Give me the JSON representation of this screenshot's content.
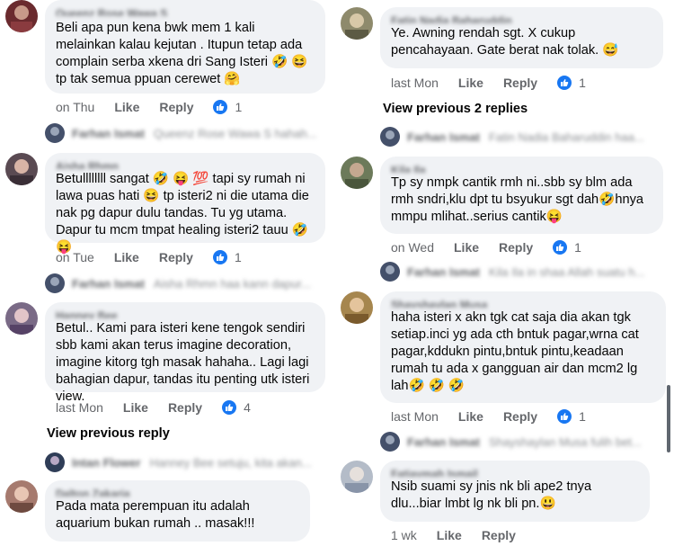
{
  "left": {
    "comments": [
      {
        "author": "Queenz Rose Wawa S",
        "text": "Beli apa pun kena bwk mem 1 kali melainkan kalau kejutan . Itupun tetap ada complain serba xkena dri Sang Isteri 🤣 😆 tp tak semua ppuan cerewet 🤗",
        "time": "on Thu",
        "like": "Like",
        "reply": "Reply",
        "reactions": "1",
        "preview": {
          "name": "Farhan Ismat",
          "text": "Queenz Rose Wawa S hahah..."
        }
      },
      {
        "author": "Aisha Rhmn",
        "text": "Betullllllll sangat 🤣 😝 💯 tapi sy rumah ni lawa puas hati 😆 tp isteri2 ni die utama die nak pg dapur dulu tandas. Tu yg utama. Dapur tu mcm tmpat healing isteri2 tauu 🤣 😝",
        "time": "on Tue",
        "like": "Like",
        "reply": "Reply",
        "reactions": "1",
        "preview": {
          "name": "Farhan Ismat",
          "text": "Aisha Rhmn haa kann dapur..."
        }
      },
      {
        "author": "Hanney Bee",
        "text": "Betul.. Kami para isteri kene tengok sendiri sbb kami akan terus imagine decoration, imagine kitorg tgh masak hahaha.. Lagi lagi bahagian dapur, tandas itu penting utk isteri view.",
        "time": "last Mon",
        "like": "Like",
        "reply": "Reply",
        "reactions": "4",
        "view_more": "View previous reply",
        "preview": {
          "name": "Intan Flower",
          "text": "Hanney Bee setuju, kita akan..."
        }
      },
      {
        "author": "Dalton Zakaria",
        "text": "Pada mata perempuan itu adalah aquarium bukan rumah .. masak!!!"
      }
    ]
  },
  "right": {
    "comments": [
      {
        "author": "Fatin Nadia Baharuddin",
        "text": "Ye. Awning rendah sgt. X cukup pencahayaan. Gate berat nak tolak. 😅",
        "time": "last Mon",
        "like": "Like",
        "reply": "Reply",
        "reactions": "1",
        "view_more": "View previous 2 replies",
        "preview": {
          "name": "Farhan Ismat",
          "text": "Fatin Nadia Baharuddin haa..."
        }
      },
      {
        "author": "Kila Ila",
        "text": "Tp sy nmpk cantik rmh ni..sbb sy blm ada rmh sndri,klu dpt tu bsyukur sgt dah🤣hnya mmpu mlihat..serius cantik😝",
        "time": "on Wed",
        "like": "Like",
        "reply": "Reply",
        "reactions": "1",
        "preview": {
          "name": "Farhan Ismat",
          "text": "Kila Ila in shaa Allah suatu h..."
        }
      },
      {
        "author": "Shayshaylan Musa",
        "text": "haha isteri x akn tgk cat saja dia akan tgk setiap.inci yg ada cth bntuk pagar,wrna cat pagar,kddukn pintu,bntuk pintu,keadaan rumah tu ada x gangguan air dan mcm2 lg lah🤣 🤣 🤣",
        "time": "last Mon",
        "like": "Like",
        "reply": "Reply",
        "reactions": "1",
        "preview": {
          "name": "Farhan Ismat",
          "text": "Shayshaylan Musa fulih bet..."
        }
      },
      {
        "author": "Fatiaymah Ismail",
        "text": "Nsib suami sy jnis nk bli ape2 tnya dlu...biar lmbt lg nk bli pn.😃",
        "time": "1 wk",
        "like": "Like",
        "reply": "Reply"
      }
    ]
  },
  "colors": {
    "bubble": "#f0f2f5",
    "meta": "#65676b",
    "like_badge": "#1877f2"
  },
  "icons": {
    "reaction": "like-thumb-icon"
  }
}
